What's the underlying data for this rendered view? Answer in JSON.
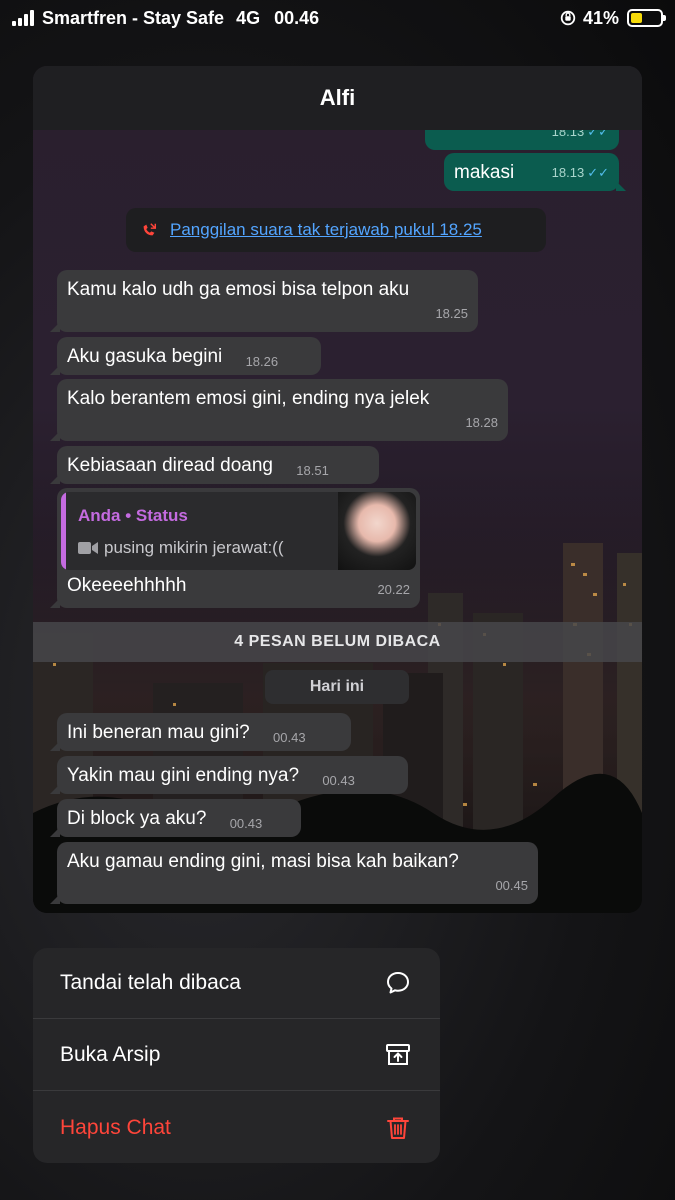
{
  "status_bar": {
    "carrier": "Smartfren - Stay Safe",
    "network": "4G",
    "time": "00.46",
    "battery_percent": "41%",
    "battery_level": 0.41
  },
  "chat": {
    "contact_name": "Alfi",
    "messages_top": [
      {
        "text": "makasi",
        "time": "18.13",
        "direction": "out"
      }
    ],
    "call_notice": "Panggilan suara tak terjawab pukul 18.25",
    "messages_mid": [
      {
        "text": "Kamu kalo udh ga emosi bisa telpon aku",
        "time": "18.25"
      },
      {
        "text": "Aku gasuka begini",
        "time": "18.26"
      },
      {
        "text": "Kalo berantem emosi gini, ending nya jelek",
        "time": "18.28"
      },
      {
        "text": "Kebiasaan diread doang",
        "time": "18.51"
      }
    ],
    "reply": {
      "author": "Anda • Status",
      "snippet": "pusing mikirin jerawat:((",
      "text": "Okeeeehhhhh",
      "time": "20.22"
    },
    "unread_label": "4 PESAN BELUM DIBACA",
    "day_label": "Hari ini",
    "messages_new": [
      {
        "text": "Ini beneran mau gini?",
        "time": "00.43"
      },
      {
        "text": "Yakin mau gini ending nya?",
        "time": "00.43"
      },
      {
        "text": "Di block ya aku?",
        "time": "00.43"
      },
      {
        "text": "Aku gamau ending gini, masi bisa kah baikan?",
        "time": "00.45"
      }
    ]
  },
  "menu": {
    "items": [
      {
        "label": "Tandai telah dibaca",
        "icon": "chat-bubble-icon"
      },
      {
        "label": "Buka Arsip",
        "icon": "archive-icon"
      },
      {
        "label": "Hapus Chat",
        "icon": "trash-icon"
      }
    ]
  },
  "colors": {
    "incoming_bubble": "#3a3a3c",
    "outgoing_bubble": "#0b5c4f",
    "link_blue": "#53a5ff",
    "status_purple": "#c46be0",
    "danger_red": "#ff453a"
  }
}
